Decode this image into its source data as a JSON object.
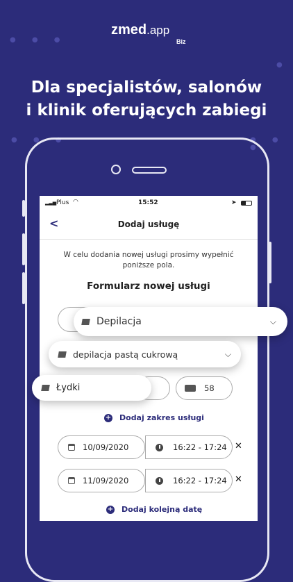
{
  "brand": {
    "name": "zmed",
    "suffix": ".app",
    "sub": "Biz"
  },
  "headline": {
    "line1": "Dla specjalistów, salonów",
    "line2": "i klinik oferujących zabiegi"
  },
  "status_bar": {
    "carrier": "Plus",
    "time": "15:52"
  },
  "nav": {
    "title": "Dodaj usługę"
  },
  "intro_text": "W celu dodania nowej usługi prosimy wypełnić poniższe pola.",
  "form_title": "Formularz nowej usługi",
  "fields": {
    "category": "Depilacja",
    "service": "depilacja pastą cukrową",
    "area": "Łydki",
    "price": "58"
  },
  "add_range_label": "Dodaj zakres usługi",
  "dates": [
    {
      "date": "10/09/2020",
      "time": "16:22 - 17:24"
    },
    {
      "date": "11/09/2020",
      "time": "16:22 - 17:24"
    }
  ],
  "add_date_label": "Dodaj kolejną datę",
  "colors": {
    "brand": "#2c2c7a",
    "background": "#2c2c7a"
  }
}
